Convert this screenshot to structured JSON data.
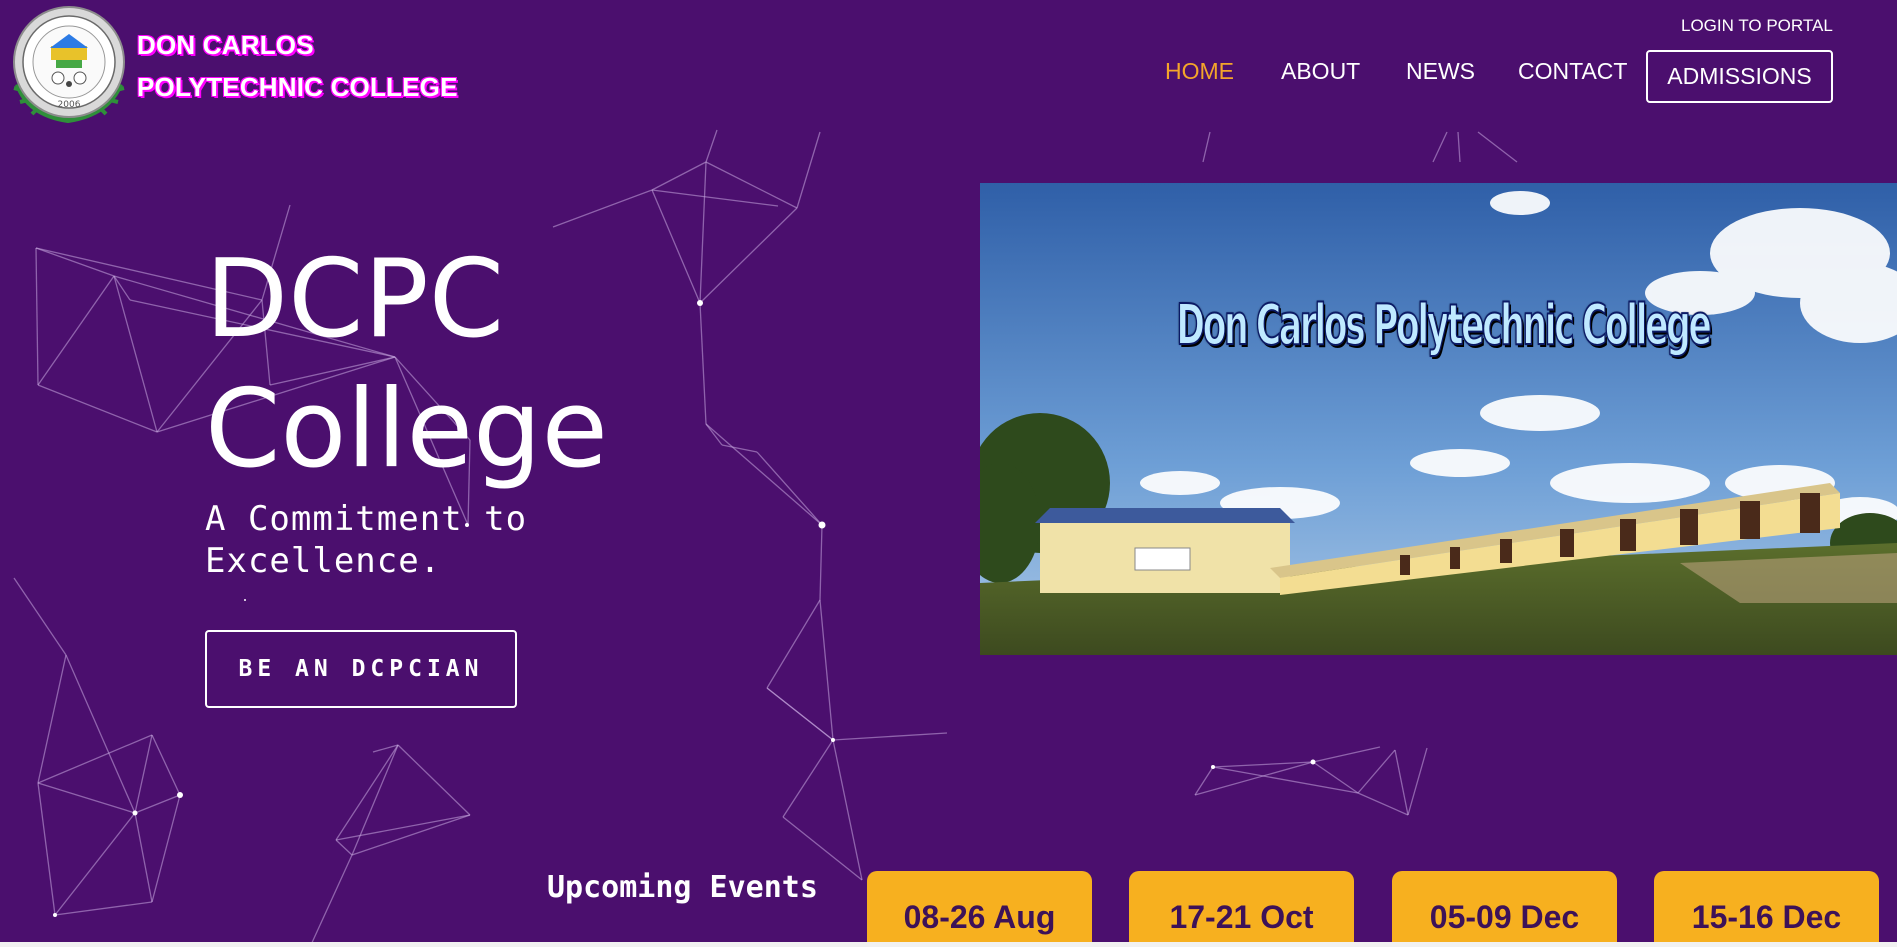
{
  "header": {
    "brand_line1": "DON CARLOS",
    "brand_line2": "POLYTECHNIC COLLEGE",
    "login_link": "LOGIN TO PORTAL",
    "nav": [
      {
        "label": "HOME",
        "active": true
      },
      {
        "label": "ABOUT",
        "active": false
      },
      {
        "label": "NEWS",
        "active": false
      },
      {
        "label": "CONTACT",
        "active": false
      }
    ],
    "admissions_button": "ADMISSIONS"
  },
  "logo": {
    "seal_top_text": "DON CARLOS POLYTECHNIC COLLEGE",
    "seal_year": "2006",
    "icon": "college-seal-icon"
  },
  "hero": {
    "title_line1": "DCPC",
    "title_line2": "College",
    "tagline_line1": "A Commitment to",
    "tagline_line2": "Excellence.",
    "cta_button": "BE AN DCPCIAN"
  },
  "photo": {
    "banner_text": "Don Carlos Polytechnic College",
    "icon": "campus-photo"
  },
  "events": {
    "heading": "Upcoming Events",
    "items": [
      {
        "date": "08-26 Aug"
      },
      {
        "date": "17-21 Oct"
      },
      {
        "date": "05-09 Dec"
      },
      {
        "date": "15-16 Dec"
      }
    ]
  },
  "colors": {
    "background": "#4b0f6e",
    "accent": "#f4a52a",
    "event_card": "#f7b01f",
    "event_text": "#3d1258"
  }
}
